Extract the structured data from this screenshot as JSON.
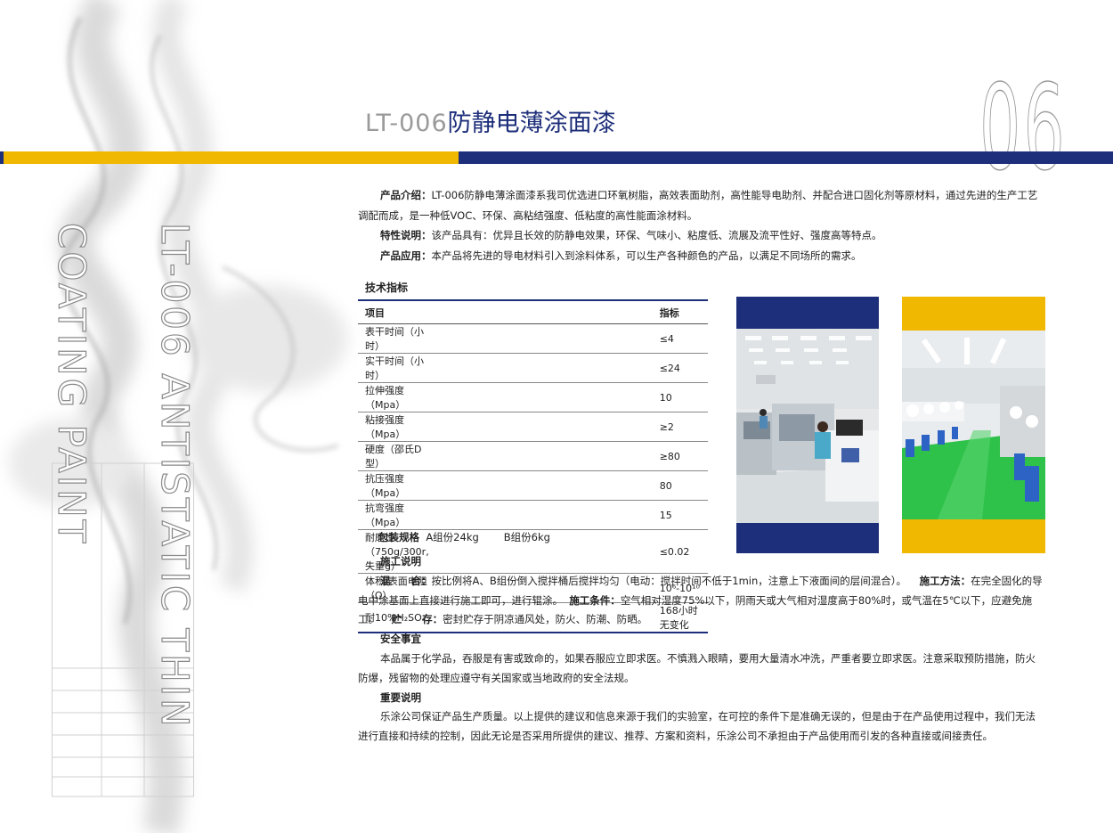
{
  "page_number": "06",
  "title": {
    "code": "LT-006",
    "name": "防静电薄涂面漆"
  },
  "vertical_text": {
    "line1": "LT-006 ANTISTATIC THIN",
    "line2": "COATING PAINT"
  },
  "intro": [
    {
      "label": "产品介绍：",
      "text": "LT-006防静电薄涂面漆系我司优选进口环氧树脂，高效表面助剂，高性能导电助剂、并配合进口固化剂等原材料，通过先进的生产工艺调配而成，是一种低VOC、环保、高粘结强度、低粘度的高性能面涂材料。"
    },
    {
      "label": "特性说明：",
      "text": "该产品具有：优异且长效的防静电效果，环保、气味小、粘度低、流展及流平性好、强度高等特点。"
    },
    {
      "label": "产品应用：",
      "text": "本产品将先进的导电材料引入到涂料体系，可以生产各种颜色的产品，以满足不同场所的需求。"
    }
  ],
  "spec": {
    "heading": "技术指标",
    "columns": [
      "项目",
      "指标"
    ],
    "rows": [
      [
        "表干时间（小时）",
        "≤4"
      ],
      [
        "实干时间（小时）",
        "≤24"
      ],
      [
        "拉伸强度（Mpa）",
        "10"
      ],
      [
        "粘接强度（Mpa）",
        "≥2"
      ],
      [
        "硬度（邵氏D型）",
        "≥80"
      ],
      [
        "抗压强度（Mpa）",
        "80"
      ],
      [
        "抗弯强度（Mpa）",
        "15"
      ],
      [
        "耐磨性（750g/300r,失重g）",
        "≤0.02"
      ],
      [
        "体积/表面电阻（Ω）",
        "10⁶-10¹⁰"
      ],
      [
        "耐10%H₂SO₄",
        "168小时无变化"
      ]
    ]
  },
  "packing": {
    "label": "包装规格",
    "a": "A组份24kg",
    "b": "B组份6kg"
  },
  "construction": {
    "heading": "施工说明",
    "mix_label": "混　　合：",
    "mix_text": "按比例将A、B组份倒入搅拌桶后搅拌均匀（电动：搅拌时间不低于1min，注意上下液面间的层间混合）。",
    "method_label": "施工方法：",
    "method_text": "在完全固化的导电中涂基面上直接进行施工即可，进行辊涂。",
    "condition_label": "施工条件：",
    "condition_text": "空气相对湿度75%以下，阴雨天或大气相对湿度高于80%时，或气温在5℃以下，应避免施工。",
    "storage_label": "贮　　存：",
    "storage_text": "密封贮存于阴凉通风处，防火、防潮、防晒。"
  },
  "safety": {
    "heading": "安全事宜",
    "text": "本品属于化学品，吞服是有害或致命的，如果吞服应立即求医。不慎溅入眼睛，要用大量清水冲洗，严重者要立即求医。注意采取预防措施，防火防爆，残留物的处理应遵守有关国家或当地政府的安全法规。"
  },
  "important": {
    "heading": "重要说明",
    "text": "乐涂公司保证产品生产质量。以上提供的建议和信息来源于我们的实验室，在可控的条件下是准确无误的，但是由于在产品使用过程中，我们无法进行直接和持续的控制，因此无论是否采用所提供的建议、推荐、方案和资料，乐涂公司不承担由于产品使用而引发的各种直接或间接责任。"
  },
  "colors": {
    "navy": "#1d2e7a",
    "gold": "#f0b800",
    "gray": "#9a9a9a",
    "floor_green": "#2fc24a"
  }
}
